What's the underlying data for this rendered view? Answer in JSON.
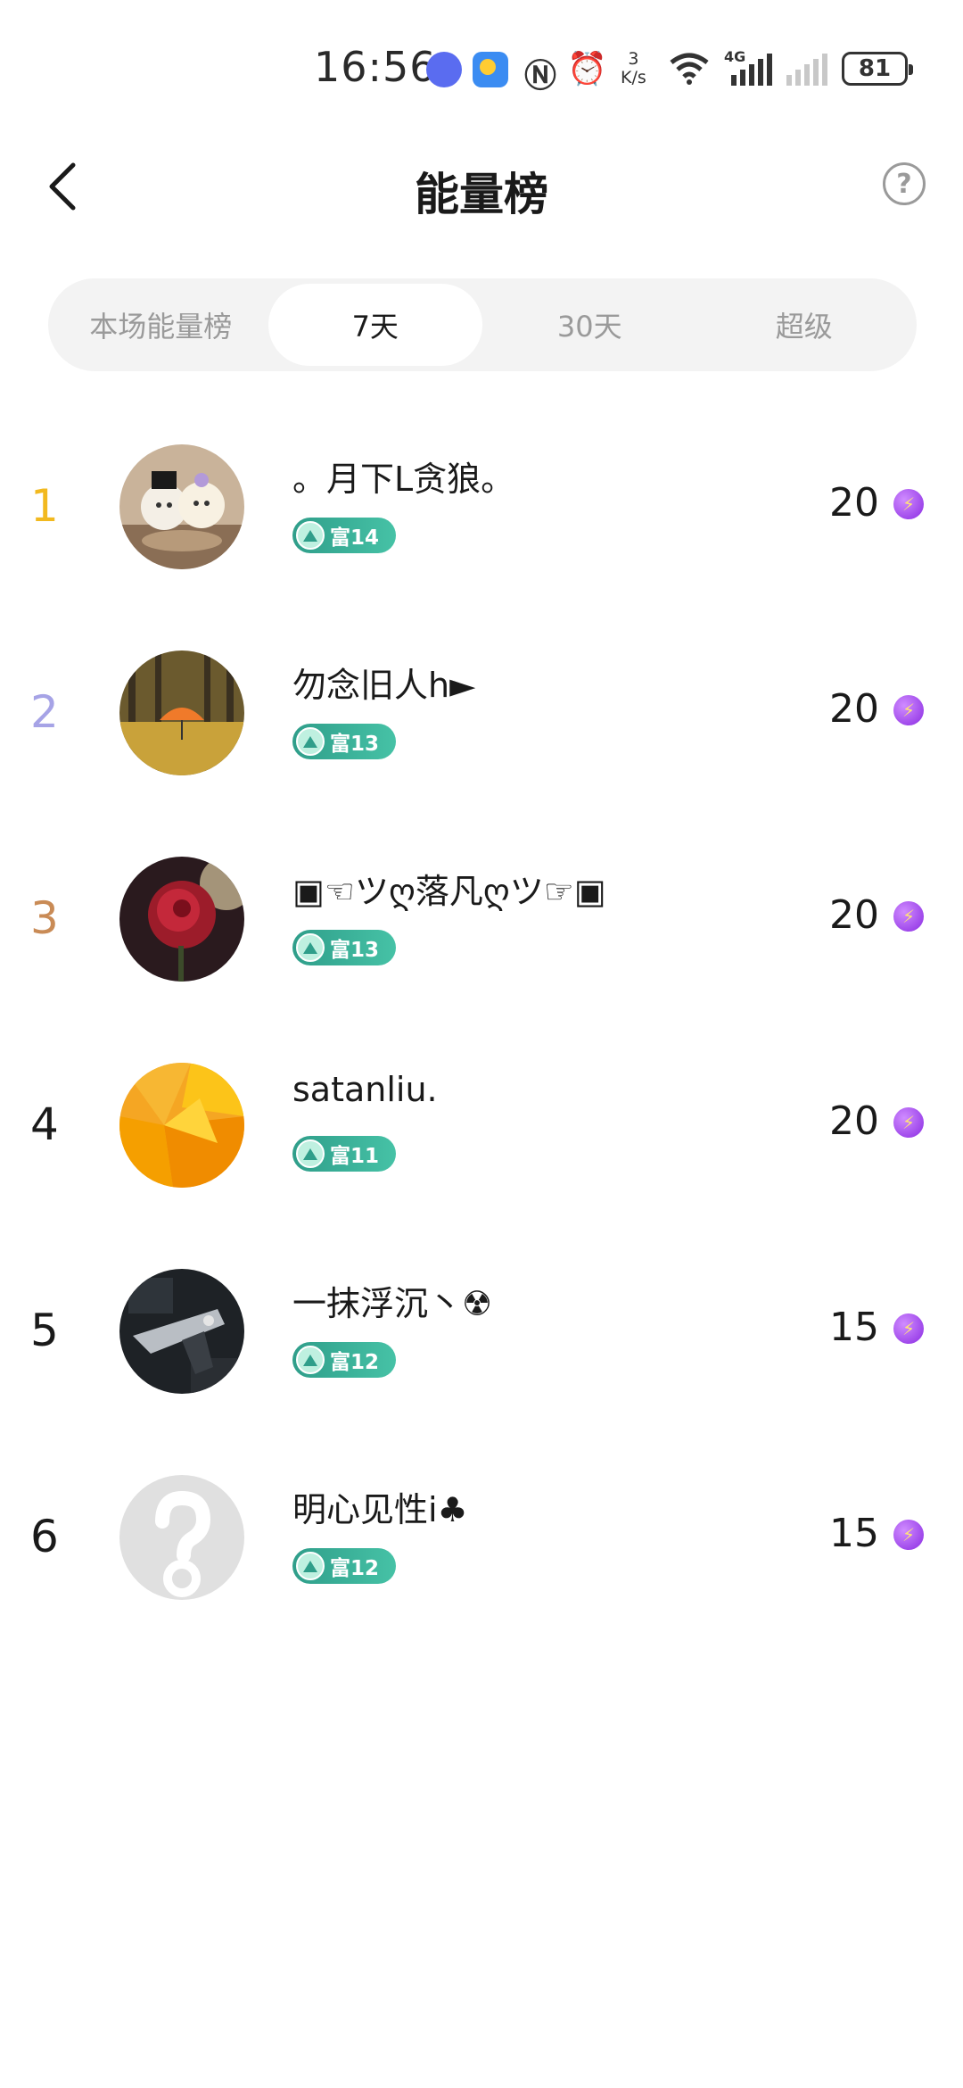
{
  "status_bar": {
    "time": "16:56",
    "speed_value": "3",
    "speed_unit": "K/s",
    "network_type": "4G",
    "battery": "81",
    "icons": [
      "music-app-icon",
      "weather-app-icon",
      "nfc-icon",
      "alarm-icon",
      "wifi-icon",
      "cellular-signal-icon",
      "no-signal-icon",
      "battery-icon"
    ]
  },
  "header": {
    "title": "能量榜",
    "back_icon": "chevron-left-icon",
    "help_label": "?"
  },
  "tabs": [
    {
      "label": "本场能量榜",
      "active": false
    },
    {
      "label": "7天",
      "active": true
    },
    {
      "label": "30天",
      "active": false
    },
    {
      "label": "超级",
      "active": false
    }
  ],
  "ranking": [
    {
      "rank": "1",
      "rank_color": "#f2b91f",
      "name": "。月下L贪狼。",
      "badge": "富14",
      "score": "20",
      "avatar": "cat-figurines-avatar"
    },
    {
      "rank": "2",
      "rank_color": "#a6a3e6",
      "name": "勿念旧人h►",
      "badge": "富13",
      "score": "20",
      "avatar": "autumn-umbrella-avatar"
    },
    {
      "rank": "3",
      "rank_color": "#c98b56",
      "name": "▣☜ツღ落凡ღツ☞▣",
      "badge": "富13",
      "score": "20",
      "avatar": "red-rose-avatar"
    },
    {
      "rank": "4",
      "rank_color": "#1a1a1a",
      "name": "satanliu.",
      "badge": "富11",
      "score": "20",
      "avatar": "yellow-polygon-avatar"
    },
    {
      "rank": "5",
      "rank_color": "#1a1a1a",
      "name": "一抹浮沉丶☢",
      "badge": "富12",
      "score": "15",
      "avatar": "pistol-avatar"
    },
    {
      "rank": "6",
      "rank_color": "#1a1a1a",
      "name": "明心见性i♣",
      "badge": "富12",
      "score": "15",
      "avatar": "question-mark-avatar"
    }
  ],
  "colors": {
    "accent_badge": "#3fb59b",
    "energy": "#8a2be2"
  }
}
